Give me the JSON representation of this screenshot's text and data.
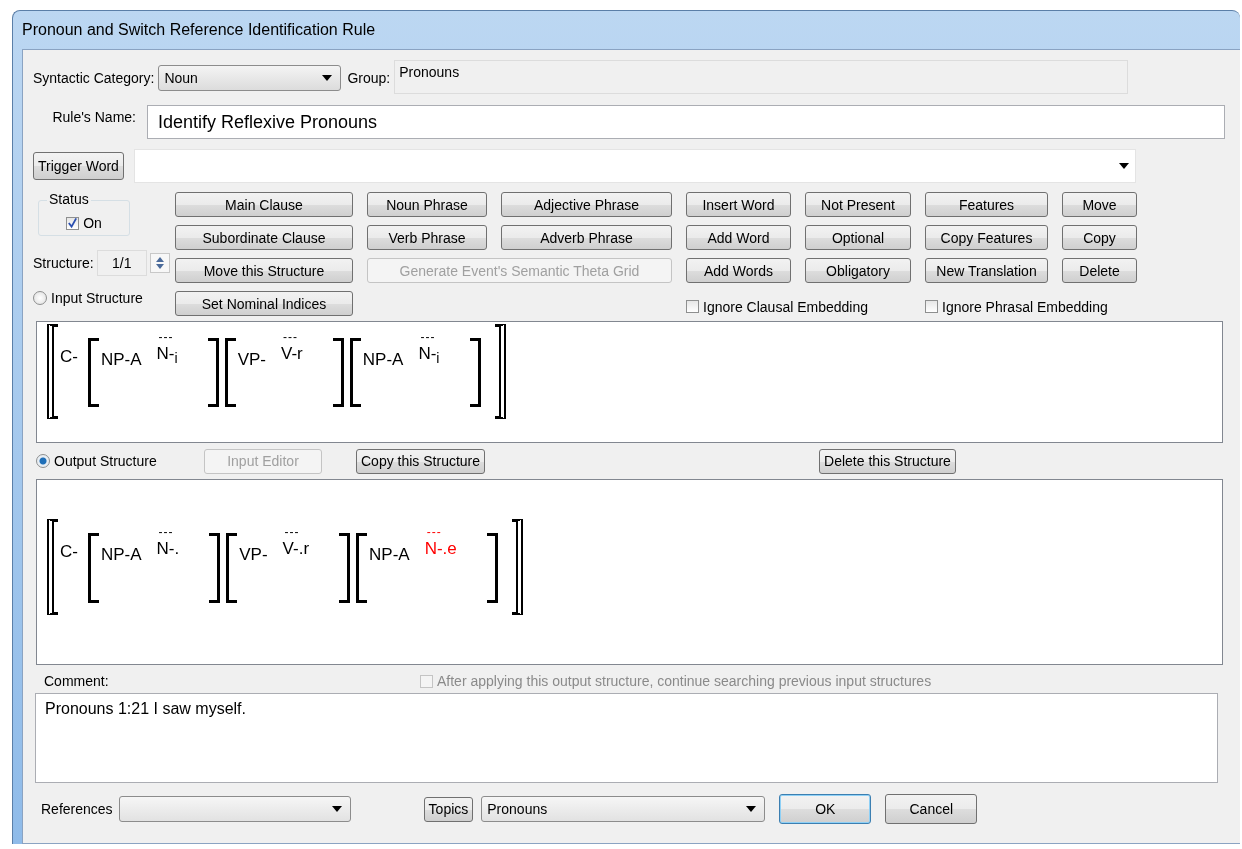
{
  "window": {
    "title": "Pronoun and Switch Reference Identification Rule"
  },
  "syntactic_category": {
    "label": "Syntactic Category:",
    "value": "Noun"
  },
  "group": {
    "label": "Group:",
    "value": "Pronouns"
  },
  "rule_name": {
    "label": "Rule's Name:",
    "value": "Identify Reflexive Pronouns"
  },
  "trigger_word": {
    "button": "Trigger Word"
  },
  "status": {
    "title": "Status",
    "label": "On",
    "checked": true
  },
  "structure": {
    "label": "Structure:",
    "value": "1/1"
  },
  "button_rows": [
    [
      {
        "label": "Main Clause",
        "disabled": false
      },
      {
        "label": "Noun Phrase",
        "disabled": false
      },
      {
        "label": "Adjective Phrase",
        "disabled": false
      },
      {
        "label": "Insert Word",
        "disabled": false
      },
      {
        "label": "Not Present",
        "disabled": false
      },
      {
        "label": "Features",
        "disabled": false
      },
      {
        "label": "Move",
        "disabled": false
      }
    ],
    [
      {
        "label": "Subordinate Clause",
        "disabled": false
      },
      {
        "label": "Verb Phrase",
        "disabled": false
      },
      {
        "label": "Adverb Phrase",
        "disabled": false
      },
      {
        "label": "Add Word",
        "disabled": false
      },
      {
        "label": "Optional",
        "disabled": false
      },
      {
        "label": "Copy Features",
        "disabled": false
      },
      {
        "label": "Copy",
        "disabled": false
      }
    ],
    [
      {
        "label": "Move this Structure",
        "disabled": false
      },
      {
        "label": "Generate Event's Semantic Theta Grid",
        "disabled": true,
        "wide": true
      },
      {
        "label": "Add Words",
        "disabled": false
      },
      {
        "label": "Obligatory",
        "disabled": false
      },
      {
        "label": "New Translation",
        "disabled": false
      },
      {
        "label": "Delete",
        "disabled": false
      }
    ],
    [
      {
        "label": "Set Nominal Indices",
        "disabled": false
      }
    ]
  ],
  "ignore_options": [
    {
      "label": "Ignore Clausal Embedding",
      "checked": false
    },
    {
      "label": "Ignore Phrasal Embedding",
      "checked": false
    }
  ],
  "input_structure": {
    "label": "Input Structure",
    "selected": false,
    "clause": {
      "label": "C-",
      "phrases": [
        {
          "label": "NP-A",
          "word": {
            "over": "---",
            "text": "N-$_{i}$",
            "highlighted": false
          }
        },
        {
          "label": "VP-",
          "word": {
            "over": "---",
            "text": "V-r",
            "highlighted": false
          }
        },
        {
          "label": "NP-A",
          "word": {
            "over": "---",
            "text": "N-$_{i}$",
            "highlighted": false
          }
        }
      ]
    }
  },
  "output_structure": {
    "label": "Output Structure",
    "selected": true,
    "buttons": [
      {
        "label": "Input Editor",
        "disabled": true
      },
      {
        "label": "Copy this Structure",
        "disabled": false
      },
      {
        "label": "Delete this Structure",
        "disabled": false
      }
    ],
    "clause": {
      "label": "C-",
      "phrases": [
        {
          "label": "NP-A",
          "word": {
            "over": "---",
            "text": "N-.",
            "highlighted": false
          }
        },
        {
          "label": "VP-",
          "word": {
            "over": "---",
            "text": "V-.r",
            "highlighted": false
          }
        },
        {
          "label": "NP-A",
          "word": {
            "over": "---",
            "text": "N-.e",
            "highlighted": true
          }
        }
      ]
    }
  },
  "comment": {
    "label": "Comment:",
    "value": "Pronouns 1:21 I saw myself."
  },
  "continue_searching": {
    "label": "After applying this output structure, continue searching previous input structures",
    "checked": false,
    "disabled": true
  },
  "references": {
    "label": "References"
  },
  "topics": {
    "button": "Topics",
    "value": "Pronouns"
  },
  "dialog_buttons": [
    {
      "label": "OK",
      "default": true
    },
    {
      "label": "Cancel",
      "default": false
    }
  ]
}
